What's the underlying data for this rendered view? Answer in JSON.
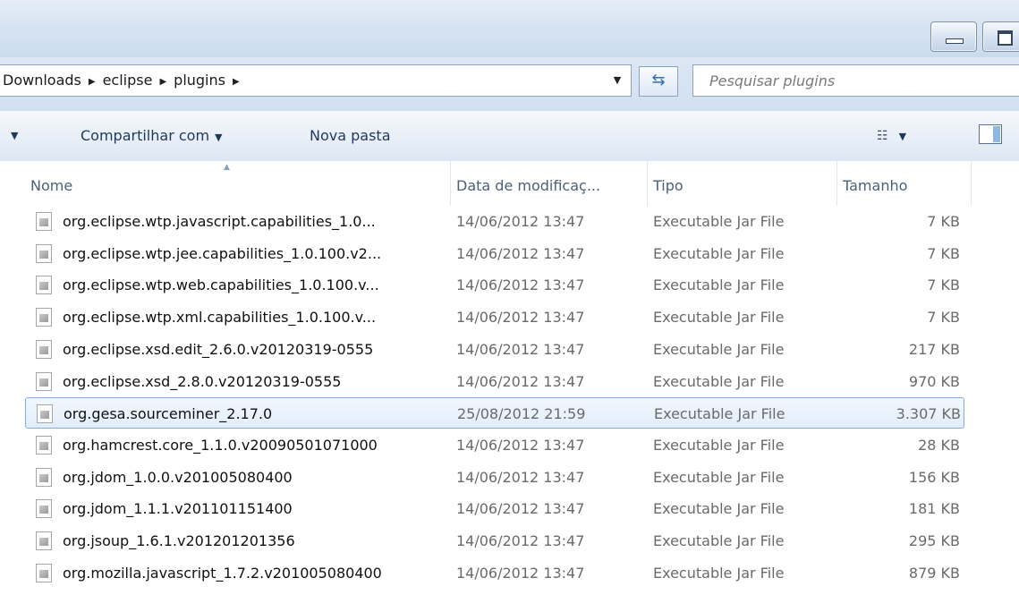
{
  "window": {
    "minimize_icon": "minimize-icon",
    "maximize_icon": "maximize-icon"
  },
  "address": {
    "breadcrumbs": [
      "Downloads",
      "eclipse",
      "plugins"
    ],
    "search_placeholder": "Pesquisar plugins"
  },
  "toolbar": {
    "share_label": "Compartilhar com",
    "new_folder_label": "Nova pasta"
  },
  "columns": {
    "name": "Nome",
    "date": "Data de modificaç...",
    "type": "Tipo",
    "size": "Tamanho"
  },
  "selected_row_index": 6,
  "files": [
    {
      "name": "org.eclipse.wtp.javascript.capabilities_1.0...",
      "date": "14/06/2012 13:47",
      "type": "Executable Jar File",
      "size": "7 KB"
    },
    {
      "name": "org.eclipse.wtp.jee.capabilities_1.0.100.v2...",
      "date": "14/06/2012 13:47",
      "type": "Executable Jar File",
      "size": "7 KB"
    },
    {
      "name": "org.eclipse.wtp.web.capabilities_1.0.100.v...",
      "date": "14/06/2012 13:47",
      "type": "Executable Jar File",
      "size": "7 KB"
    },
    {
      "name": "org.eclipse.wtp.xml.capabilities_1.0.100.v...",
      "date": "14/06/2012 13:47",
      "type": "Executable Jar File",
      "size": "7 KB"
    },
    {
      "name": "org.eclipse.xsd.edit_2.6.0.v20120319-0555",
      "date": "14/06/2012 13:47",
      "type": "Executable Jar File",
      "size": "217 KB"
    },
    {
      "name": "org.eclipse.xsd_2.8.0.v20120319-0555",
      "date": "14/06/2012 13:47",
      "type": "Executable Jar File",
      "size": "970 KB"
    },
    {
      "name": "org.gesa.sourceminer_2.17.0",
      "date": "25/08/2012 21:59",
      "type": "Executable Jar File",
      "size": "3.307 KB"
    },
    {
      "name": "org.hamcrest.core_1.1.0.v20090501071000",
      "date": "14/06/2012 13:47",
      "type": "Executable Jar File",
      "size": "28 KB"
    },
    {
      "name": "org.jdom_1.0.0.v201005080400",
      "date": "14/06/2012 13:47",
      "type": "Executable Jar File",
      "size": "156 KB"
    },
    {
      "name": "org.jdom_1.1.1.v201101151400",
      "date": "14/06/2012 13:47",
      "type": "Executable Jar File",
      "size": "181 KB"
    },
    {
      "name": "org.jsoup_1.6.1.v201201201356",
      "date": "14/06/2012 13:47",
      "type": "Executable Jar File",
      "size": "295 KB"
    },
    {
      "name": "org.mozilla.javascript_1.7.2.v201005080400",
      "date": "14/06/2012 13:47",
      "type": "Executable Jar File",
      "size": "879 KB"
    }
  ]
}
